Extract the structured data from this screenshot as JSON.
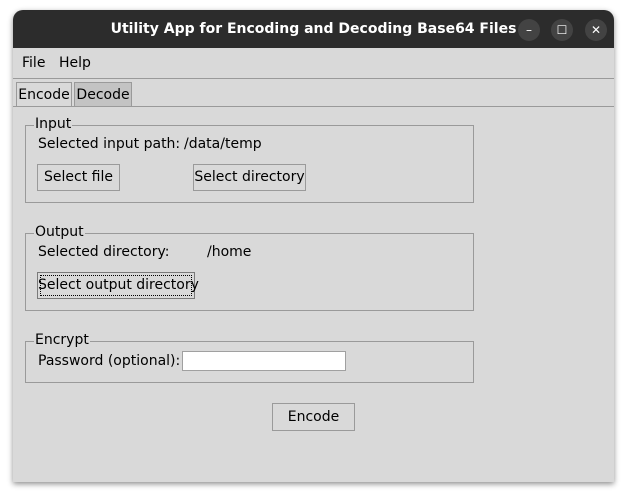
{
  "window": {
    "title": "Utility App for Encoding and Decoding Base64 Files"
  },
  "window_controls": {
    "minimize": "–",
    "maximize": "☐",
    "close": "✕"
  },
  "menu": [
    "File",
    "Help"
  ],
  "tabs": [
    {
      "label": "Encode",
      "active": true
    },
    {
      "label": "Decode",
      "active": false
    }
  ],
  "input_group": {
    "legend": "Input",
    "path_label": "Selected input path:",
    "path_value": "/data/temp",
    "select_file_label": "Select file",
    "select_directory_label": "Select directory"
  },
  "output_group": {
    "legend": "Output",
    "dir_label": "Selected directory:",
    "dir_value": "/home",
    "select_output_label": "Select output directory"
  },
  "encrypt_group": {
    "legend": "Encrypt",
    "password_label": "Password (optional):",
    "password_value": ""
  },
  "action": {
    "encode_label": "Encode"
  }
}
